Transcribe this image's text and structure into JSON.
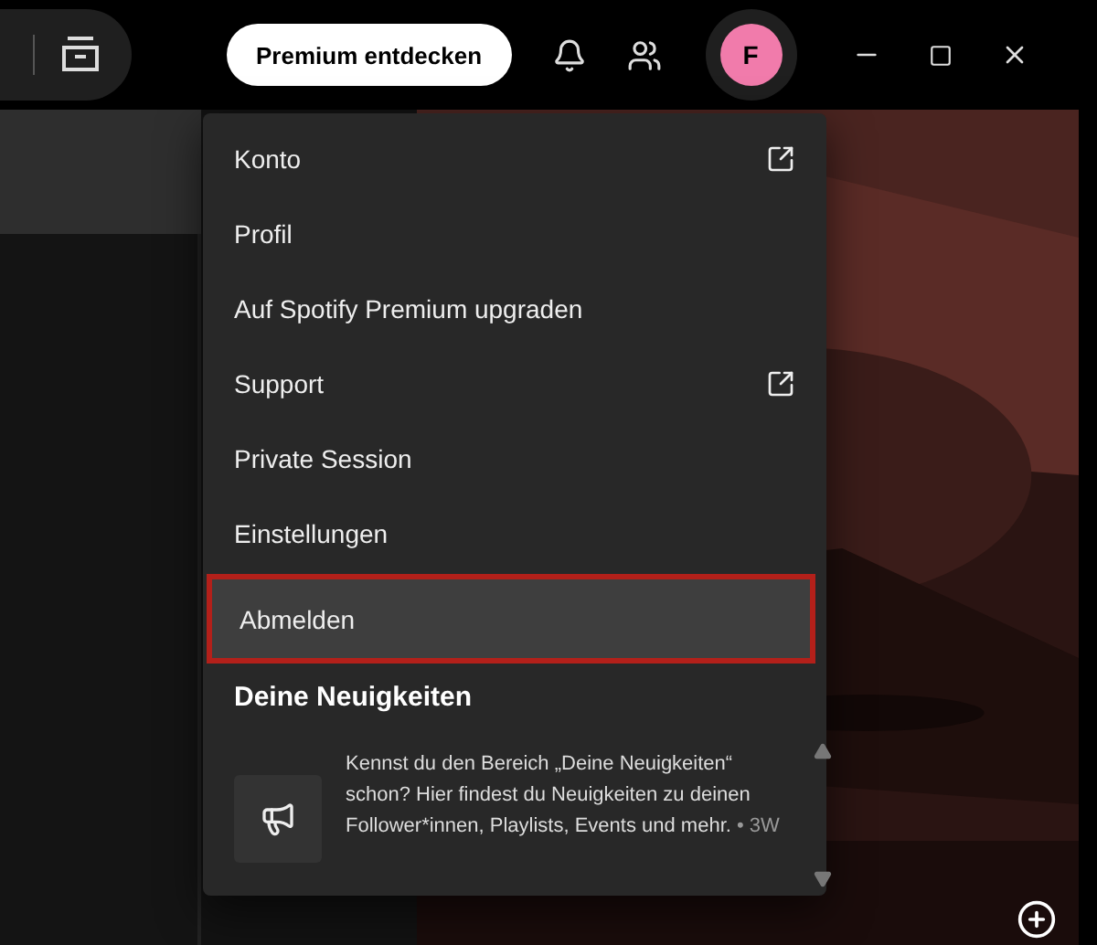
{
  "topbar": {
    "premium_button": "Premium entdecken",
    "avatar_letter": "F"
  },
  "menu": {
    "items": [
      {
        "label": "Konto",
        "external": true,
        "selected": false
      },
      {
        "label": "Profil",
        "external": false,
        "selected": false
      },
      {
        "label": "Auf Spotify Premium upgraden",
        "external": false,
        "selected": false
      },
      {
        "label": "Support",
        "external": true,
        "selected": false
      },
      {
        "label": "Private Session",
        "external": false,
        "selected": false
      },
      {
        "label": "Einstellungen",
        "external": false,
        "selected": false
      },
      {
        "label": "Abmelden",
        "external": false,
        "selected": true
      }
    ],
    "news": {
      "title": "Deine Neuigkeiten",
      "items": [
        {
          "text": "Kennst du den Bereich „Deine Neuigkeiten“ schon? Hier findest du Neuigkeiten zu deinen Follower*innen, Playlists, Events und mehr.",
          "age": "• 3W"
        }
      ]
    }
  }
}
